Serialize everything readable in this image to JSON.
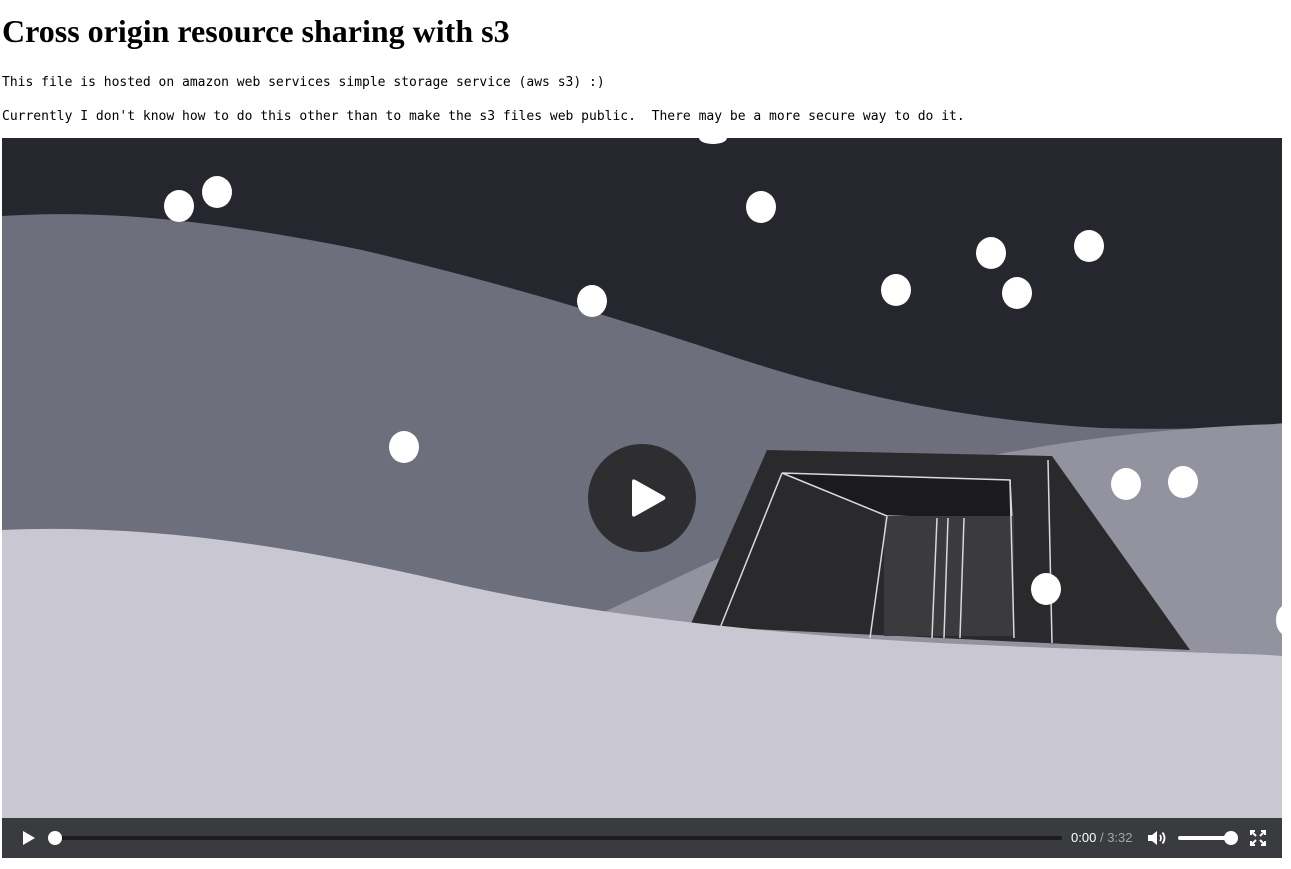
{
  "page": {
    "heading": "Cross origin resource sharing with s3",
    "paragraphs": [
      "This file is hosted on amazon web services simple storage service (aws s3) :)",
      "Currently I don't know how to do this other than to make the s3 files web public.  There may be a more secure way to do it."
    ]
  },
  "video": {
    "current_time": "0:00",
    "separator": "/",
    "duration": "3:32",
    "progress_fraction": 0,
    "volume_fraction": 1,
    "icons": {
      "big_play": "play-icon",
      "play": "play-icon",
      "volume": "volume-icon",
      "fullscreen": "fullscreen-icon"
    },
    "colors": {
      "controls_bar": "#3a3b3e",
      "sky": "#26262e",
      "snow": "#c9c8d2"
    }
  }
}
